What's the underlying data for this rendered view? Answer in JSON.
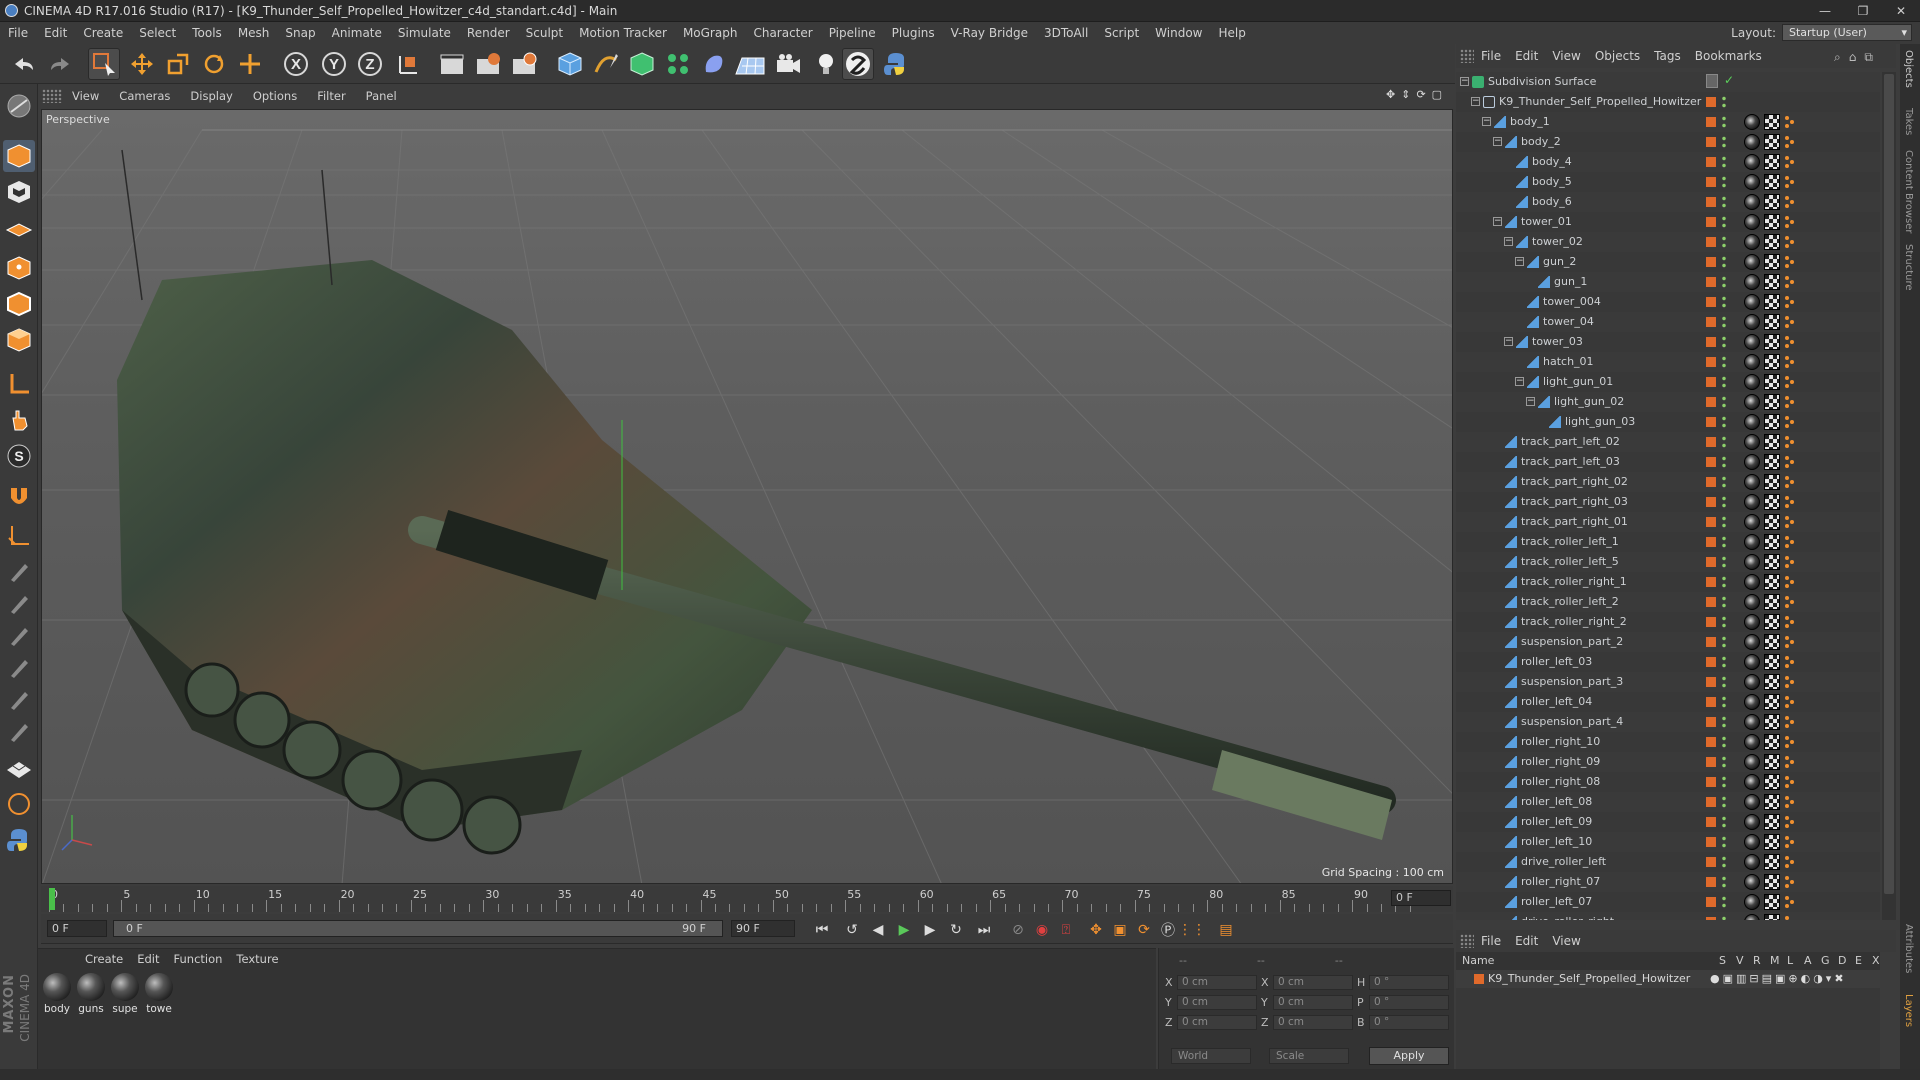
{
  "window": {
    "title": "CINEMA 4D R17.016 Studio (R17) - [K9_Thunder_Self_Propelled_Howitzer_c4d_standart.c4d] - Main",
    "minimize": "—",
    "maximize": "❐",
    "close": "✕"
  },
  "menu": [
    "File",
    "Edit",
    "Create",
    "Select",
    "Tools",
    "Mesh",
    "Snap",
    "Animate",
    "Simulate",
    "Render",
    "Sculpt",
    "Motion Tracker",
    "MoGraph",
    "Character",
    "Pipeline",
    "Plugins",
    "V-Ray Bridge",
    "3DToAll",
    "Script",
    "Window",
    "Help"
  ],
  "layout": {
    "label": "Layout:",
    "value": "Startup (User)"
  },
  "toolbar": {
    "axis_x": "X",
    "axis_y": "Y",
    "axis_z": "Z"
  },
  "viewport": {
    "menu": [
      "View",
      "Cameras",
      "Display",
      "Options",
      "Filter",
      "Panel"
    ],
    "camera_label": "Perspective",
    "grid_spacing": "Grid Spacing : 100 cm"
  },
  "timeline": {
    "ticks": [
      "0",
      "5",
      "10",
      "15",
      "20",
      "25",
      "30",
      "35",
      "40",
      "45",
      "50",
      "55",
      "60",
      "65",
      "70",
      "75",
      "80",
      "85",
      "90"
    ],
    "current_frame": "0 F",
    "start_field": "0 F",
    "slider_start": "0 F",
    "slider_end": "90 F",
    "end_field": "90 F"
  },
  "materials": {
    "menu": [
      "Create",
      "Edit",
      "Function",
      "Texture"
    ],
    "items": [
      "body",
      "guns",
      "supe",
      "towe"
    ]
  },
  "coords": {
    "header": [
      "--",
      "--",
      "--"
    ],
    "rows": [
      {
        "a": "X",
        "v1": "0 cm",
        "b": "X",
        "v2": "0 cm",
        "c": "H",
        "v3": "0 °"
      },
      {
        "a": "Y",
        "v1": "0 cm",
        "b": "Y",
        "v2": "0 cm",
        "c": "P",
        "v3": "0 °"
      },
      {
        "a": "Z",
        "v1": "0 cm",
        "b": "Z",
        "v2": "0 cm",
        "c": "B",
        "v3": "0 °"
      }
    ],
    "space": "World",
    "mode": "Scale",
    "apply": "Apply"
  },
  "objects": {
    "menu": [
      "File",
      "Edit",
      "View",
      "Objects",
      "Tags",
      "Bookmarks"
    ],
    "tree": [
      {
        "name": "Subdivision Surface",
        "depth": 0
      },
      {
        "name": "K9_Thunder_Self_Propelled_Howitzer",
        "depth": 1
      },
      {
        "name": "body_1",
        "depth": 2
      },
      {
        "name": "body_2",
        "depth": 3
      },
      {
        "name": "body_4",
        "depth": 4
      },
      {
        "name": "body_5",
        "depth": 4
      },
      {
        "name": "body_6",
        "depth": 4
      },
      {
        "name": "tower_01",
        "depth": 3
      },
      {
        "name": "tower_02",
        "depth": 4
      },
      {
        "name": "gun_2",
        "depth": 5
      },
      {
        "name": "gun_1",
        "depth": 6
      },
      {
        "name": "tower_004",
        "depth": 5
      },
      {
        "name": "tower_04",
        "depth": 5
      },
      {
        "name": "tower_03",
        "depth": 4
      },
      {
        "name": "hatch_01",
        "depth": 5
      },
      {
        "name": "light_gun_01",
        "depth": 5
      },
      {
        "name": "light_gun_02",
        "depth": 6
      },
      {
        "name": "light_gun_03",
        "depth": 7
      },
      {
        "name": "track_part_left_02",
        "depth": 3
      },
      {
        "name": "track_part_left_03",
        "depth": 3
      },
      {
        "name": "track_part_right_02",
        "depth": 3
      },
      {
        "name": "track_part_right_03",
        "depth": 3
      },
      {
        "name": "track_part_right_01",
        "depth": 3
      },
      {
        "name": "track_roller_left_1",
        "depth": 3
      },
      {
        "name": "track_roller_left_5",
        "depth": 3
      },
      {
        "name": "track_roller_right_1",
        "depth": 3
      },
      {
        "name": "track_roller_left_2",
        "depth": 3
      },
      {
        "name": "track_roller_right_2",
        "depth": 3
      },
      {
        "name": "suspension_part_2",
        "depth": 3
      },
      {
        "name": "roller_left_03",
        "depth": 3
      },
      {
        "name": "suspension_part_3",
        "depth": 3
      },
      {
        "name": "roller_left_04",
        "depth": 3
      },
      {
        "name": "suspension_part_4",
        "depth": 3
      },
      {
        "name": "roller_right_10",
        "depth": 3
      },
      {
        "name": "roller_right_09",
        "depth": 3
      },
      {
        "name": "roller_right_08",
        "depth": 3
      },
      {
        "name": "roller_left_08",
        "depth": 3
      },
      {
        "name": "roller_left_09",
        "depth": 3
      },
      {
        "name": "roller_left_10",
        "depth": 3
      },
      {
        "name": "drive_roller_left",
        "depth": 3
      },
      {
        "name": "roller_right_07",
        "depth": 3
      },
      {
        "name": "roller_left_07",
        "depth": 3
      },
      {
        "name": "drive_roller_right",
        "depth": 3
      }
    ]
  },
  "layers": {
    "menu": [
      "File",
      "Edit",
      "View"
    ],
    "columns": [
      "Name",
      "S",
      "V",
      "R",
      "M",
      "L",
      "A",
      "G",
      "D",
      "E",
      "X"
    ],
    "row_name": "K9_Thunder_Self_Propelled_Howitzer"
  },
  "side_tabs": [
    "Objects",
    "Takes",
    "Content Browser",
    "Structure",
    "Attributes",
    "Layers"
  ],
  "branding": {
    "maxon": "MAXON",
    "product": "CINEMA 4D"
  }
}
